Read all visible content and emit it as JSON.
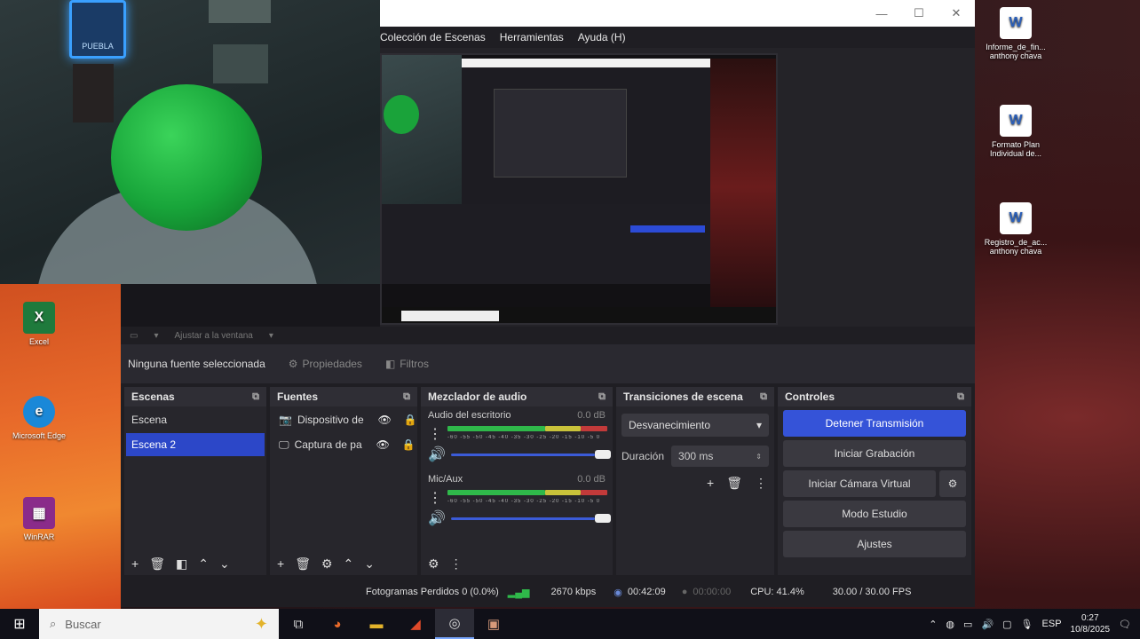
{
  "webcam": {
    "sign_text": "PUEBLA"
  },
  "desktop_left": {
    "icons": [
      {
        "label": "Excel",
        "glyph": "X",
        "color": "#1f7a3c"
      },
      {
        "label": "Microsoft Edge",
        "glyph": "e",
        "color": "#1a88d8"
      },
      {
        "label": "WinRAR",
        "glyph": "▦",
        "color": "#8a2b8a"
      }
    ]
  },
  "desktop_right": {
    "icons": [
      {
        "label": "Informe_de_fin... anthony chava",
        "glyph": "W",
        "color": "#2b5fb8"
      },
      {
        "label": "Formato Plan Individual de...",
        "glyph": "W",
        "color": "#2b5fb8"
      },
      {
        "label": "Registro_de_ac... anthony chava",
        "glyph": "W",
        "color": "#2b5fb8"
      }
    ]
  },
  "window": {
    "minimize": "—",
    "maximize": "☐",
    "close": "✕"
  },
  "menu": [
    "Colección de Escenas",
    "Herramientas",
    "Ayuda (H)"
  ],
  "preview_controls": {
    "zoom": "Ajustar a la ventana"
  },
  "source_toolbar": {
    "no_source": "Ninguna fuente seleccionada",
    "properties": "Propiedades",
    "filters": "Filtros"
  },
  "scenes": {
    "title": "Escenas",
    "items": [
      "Escena",
      "Escena 2"
    ],
    "active_index": 1
  },
  "sources": {
    "title": "Fuentes",
    "items": [
      {
        "label": "Dispositivo de",
        "icon": "camera-icon"
      },
      {
        "label": "Captura de pa",
        "icon": "monitor-icon"
      }
    ]
  },
  "mixer": {
    "title": "Mezclador de audio",
    "channels": [
      {
        "name": "Audio del escritorio",
        "db": "0.0 dB",
        "level": 0.95,
        "volume": 1.0
      },
      {
        "name": "Mic/Aux",
        "db": "0.0 dB",
        "level": 0.95,
        "volume": 1.0
      }
    ],
    "ticks": "-60 -55 -50 -45 -40 -35 -30 -25 -20 -15 -10 -5 0"
  },
  "transitions": {
    "title": "Transiciones de escena",
    "selected": "Desvanecimiento",
    "duration_label": "Duración",
    "duration_value": "300 ms"
  },
  "controls": {
    "title": "Controles",
    "stop_stream": "Detener Transmisión",
    "start_recording": "Iniciar Grabación",
    "start_virtual_cam": "Iniciar Cámara Virtual",
    "studio_mode": "Modo Estudio",
    "settings": "Ajustes"
  },
  "status": {
    "dropped_frames": "Fotogramas Perdidos 0 (0.0%)",
    "bitrate": "2670 kbps",
    "stream_time": "00:42:09",
    "rec_time": "00:00:00",
    "cpu": "CPU: 41.4%",
    "fps": "30.00 / 30.00 FPS"
  },
  "taskbar": {
    "search_placeholder": "Buscar",
    "time": "0:27",
    "date": "10/8/2025",
    "lang": "ESP"
  },
  "colors": {
    "accent": "#3553d8",
    "dock_bg": "#27262c",
    "meter_green": "#2fb84a",
    "meter_yellow": "#c9c23a",
    "meter_red": "#c23a3a"
  }
}
